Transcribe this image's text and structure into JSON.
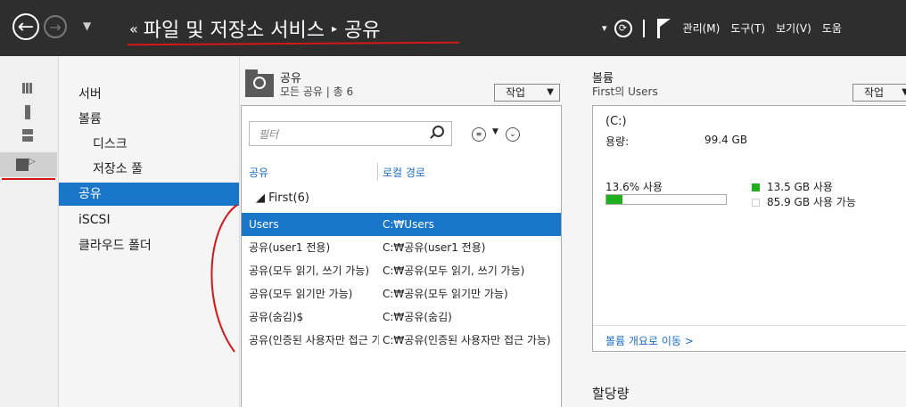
{
  "topbar": {
    "back_icon": "arrow-left-icon",
    "forward_icon": "arrow-right-icon",
    "history_caret": "▼",
    "crumb_prefix": "«",
    "crumb_sep": "▸",
    "crumbs": [
      "파일 및 저장소 서비스",
      "공유"
    ],
    "refresh_glyph": "⟳",
    "menu": [
      "관리(M)",
      "도구(T)",
      "보기(V)",
      "도움"
    ]
  },
  "sidebar": {
    "items": [
      {
        "label": "서버"
      },
      {
        "label": "볼륨"
      },
      {
        "label": "디스크"
      },
      {
        "label": "저장소 풀"
      },
      {
        "label": "공유"
      },
      {
        "label": "iSCSI"
      },
      {
        "label": "클라우드 폴더"
      }
    ]
  },
  "shares_panel": {
    "title": "공유",
    "subtitle": "모든 공유 | 총 6",
    "tasks_label": "작업",
    "filter_placeholder": "필터",
    "columns": [
      "공유",
      "로컬 경로"
    ],
    "group_label": "First(6)",
    "rows": [
      {
        "share": "Users",
        "path": "C:₩Users",
        "selected": true
      },
      {
        "share": "공유(user1 전용)",
        "path": "C:₩공유(user1 전용)"
      },
      {
        "share": "공유(모두 읽기, 쓰기 가능)",
        "path": "C:₩공유(모두 읽기, 쓰기 가능)"
      },
      {
        "share": "공유(모두 읽기만 가능)",
        "path": "C:₩공유(모두 읽기만 가능)"
      },
      {
        "share": "공유(숨김)$",
        "path": "C:₩공유(숨김)"
      },
      {
        "share": "공유(인증된 사용자만 접근 가능)",
        "path": "C:₩공유(인증된 사용자만 접근 가능)"
      }
    ]
  },
  "volume_panel": {
    "title": "볼륨",
    "subtitle": "First의 Users",
    "tasks_label": "작업",
    "drive": "(C:)",
    "capacity_label": "용량:",
    "capacity_value": "99.4 GB",
    "used_percent_text": "13.6% 사용",
    "used_fraction": 0.136,
    "legend": [
      {
        "text": "13.5 GB 사용",
        "color": "#1fb01f"
      },
      {
        "text": "85.9 GB 사용 가능",
        "color": "#ffffff"
      }
    ],
    "goto_link": "볼륨 개요로 이동 >"
  },
  "quota_title": "할당량",
  "colors": {
    "accent": "#1a76c8",
    "annotation": "#d41818",
    "used": "#1fb01f"
  }
}
